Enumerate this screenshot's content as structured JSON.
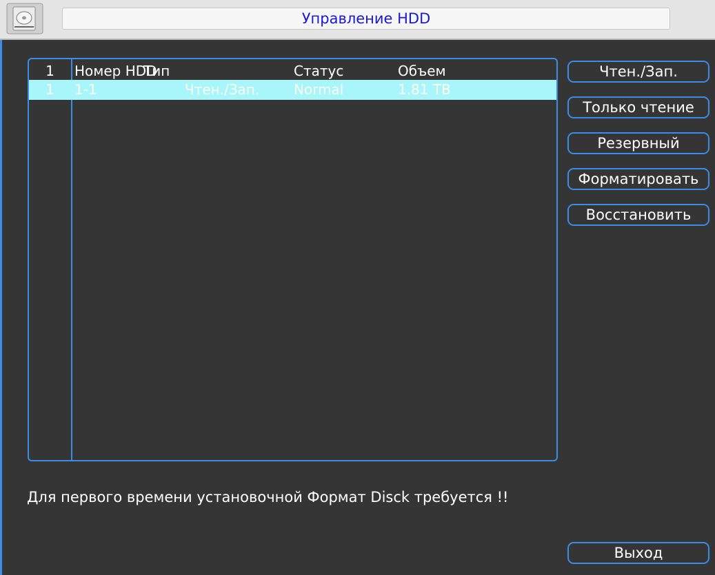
{
  "window": {
    "title": "Управление HDD",
    "icon": "hdd-icon"
  },
  "table": {
    "headers": {
      "index": "1",
      "hdd_number": "Номер HDD",
      "type": "Тип",
      "status": "Статус",
      "capacity": "Объем"
    },
    "rows": [
      {
        "index": "1",
        "hdd_number": "1-1",
        "type": "Чтен./Зап.",
        "status": "Normal",
        "capacity": "1.81 TB",
        "selected": true
      }
    ]
  },
  "buttons": {
    "read_write": "Чтен./Зап.",
    "read_only": "Только чтение",
    "redundant": "Резервный",
    "format": "Форматировать",
    "recover": "Восстановить",
    "exit": "Выход"
  },
  "message": "Для первого времени установочной Формат Disck требуется !!",
  "colors": {
    "accent": "#3a8ee8",
    "background": "#353535",
    "selection": "#a8f6fa",
    "title_text": "#1818d8"
  }
}
